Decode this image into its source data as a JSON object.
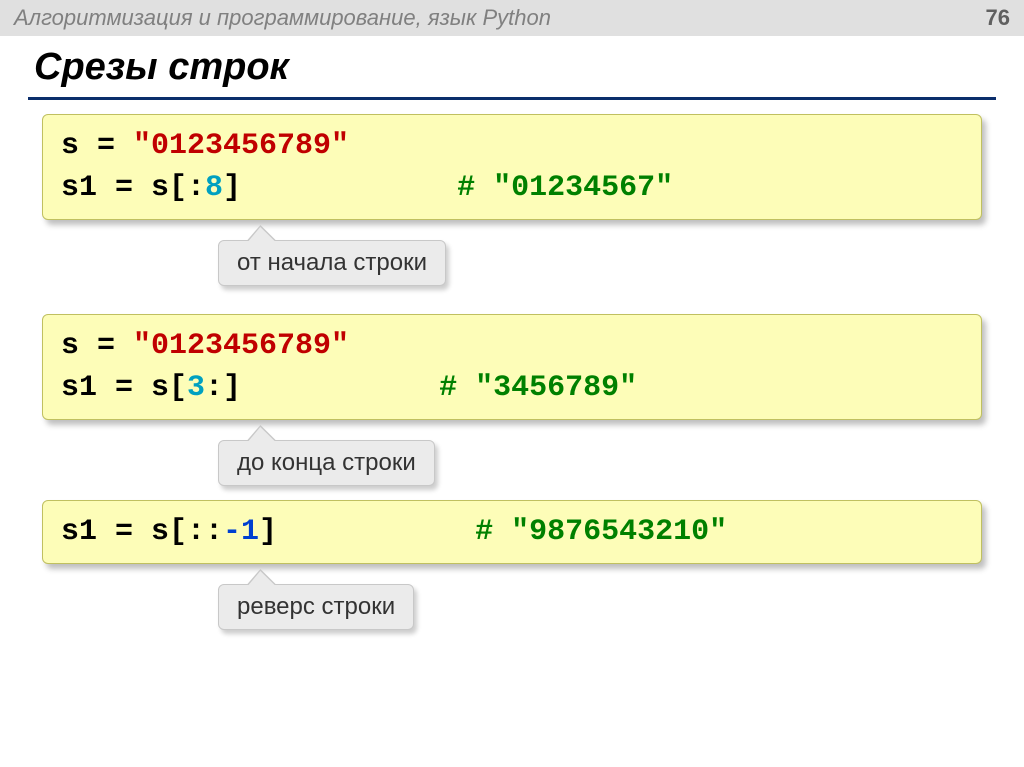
{
  "header": {
    "title": "Алгоритмизация и программирование, язык Python",
    "page": "76"
  },
  "title": "Срезы строк",
  "box1": {
    "line1_pre": "s = ",
    "line1_str": "\"0123456789\"",
    "line2_pre": "s1 = s[:",
    "line2_num": "8",
    "line2_post": "]",
    "line2_hash": "#",
    "line2_comment": " \"01234567\""
  },
  "callout1": "от начала строки",
  "box2": {
    "line1_pre": "s = ",
    "line1_str": "\"0123456789\"",
    "line2_pre": "s1 = s[",
    "line2_num": "3",
    "line2_post": ":]",
    "line2_hash": "#",
    "line2_comment": " \"3456789\""
  },
  "callout2": "до конца строки",
  "box3": {
    "line_pre": "s1 = ",
    "line_s": "s[::",
    "line_num": "-1",
    "line_post": "]",
    "line_hash": "#",
    "line_comment": " \"9876543210\""
  },
  "callout3": "реверс строки"
}
